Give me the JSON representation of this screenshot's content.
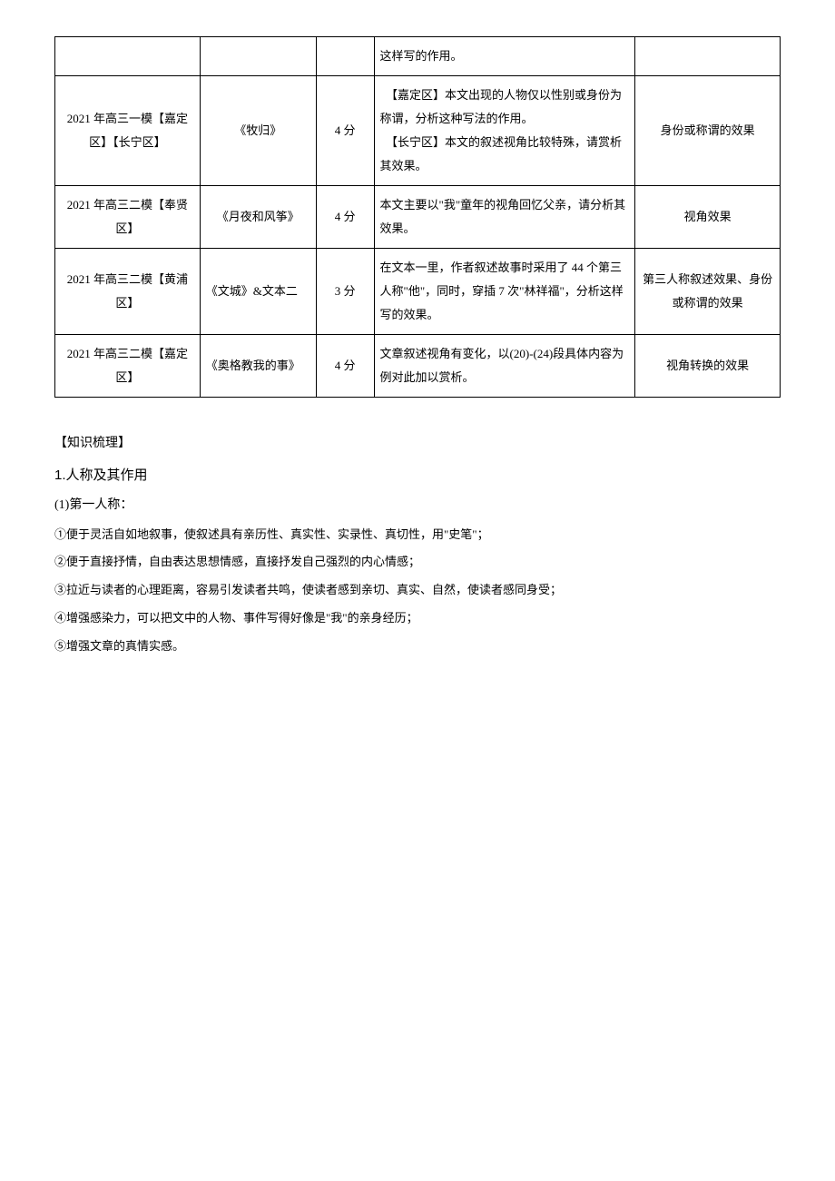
{
  "table": {
    "rows": [
      {
        "col1": "",
        "col2": "",
        "col3": "",
        "col4": "这样写的作用。",
        "col5": ""
      },
      {
        "col1": "2021 年高三一模【嘉定区】【长宁区】",
        "col2": "《牧归》",
        "col3": "4 分",
        "col4_a": "　【嘉定区】本文出现的人物仅以性别或身份为称谓，分析这种写法的作用。",
        "col4_b": "　【长宁区】本文的叙述视角比较特殊，请赏析其效果。",
        "col5": "身份或称谓的效果"
      },
      {
        "col1": "2021 年高三二模【奉贤区】",
        "col2": "《月夜和风筝》",
        "col3": "4 分",
        "col4": "本文主要以\"我\"童年的视角回忆父亲，请分析其效果。",
        "col5": "视角效果"
      },
      {
        "col1": "2021 年高三二模【黄浦区】",
        "col2": "《文城》&文本二",
        "col3": "3 分",
        "col4": "在文本一里，作者叙述故事时采用了 44 个第三人称\"他\"，同时，穿插 7 次\"林祥福\"，分析这样写的效果。",
        "col5": "第三人称叙述效果、身份或称谓的效果"
      },
      {
        "col1": "2021 年高三二模【嘉定区】",
        "col2": "《奥格教我的事》",
        "col3": "4 分",
        "col4": "文章叙述视角有变化，以(20)-(24)段具体内容为例对此加以赏析。",
        "col5": "视角转换的效果"
      }
    ]
  },
  "sections": {
    "knowledge_heading": "【知识梳理】",
    "person_heading": "1.人称及其作用",
    "first_person_heading": "(1)第一人称：",
    "lines": [
      "①便于灵活自如地叙事，使叙述具有亲历性、真实性、实录性、真切性，用\"史笔\"；",
      "②便于直接抒情，自由表达思想情感，直接抒发自己强烈的内心情感；",
      "③拉近与读者的心理距离，容易引发读者共鸣，使读者感到亲切、真实、自然，使读者感同身受；",
      "④增强感染力，可以把文中的人物、事件写得好像是\"我\"的亲身经历；",
      "⑤增强文章的真情实感。"
    ]
  }
}
